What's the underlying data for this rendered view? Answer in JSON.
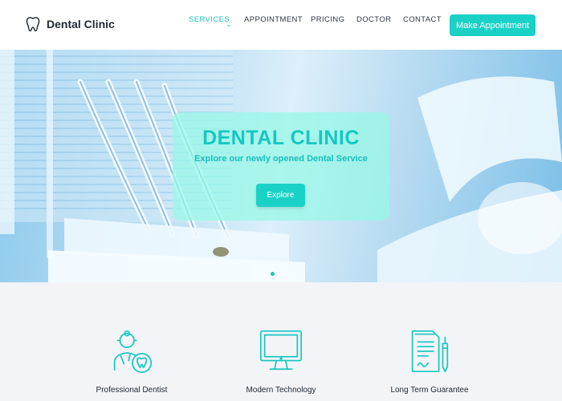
{
  "brand": {
    "name": "Dental Clinic",
    "icon": "tooth-icon"
  },
  "nav": {
    "items": [
      {
        "label": "SERVICES",
        "active": true,
        "has_dropdown": true
      },
      {
        "label": "APPOINTMENT",
        "active": false
      },
      {
        "label": "PRICING",
        "active": false
      },
      {
        "label": "DOCTOR",
        "active": false
      },
      {
        "label": "CONTACT",
        "active": false
      }
    ],
    "cta_label": "Make Appointment"
  },
  "hero": {
    "title": "DENTAL CLINIC",
    "subtitle": "Explore our newly opened Dental Service",
    "button_label": "Explore",
    "slide_count": 3,
    "active_slide": 1
  },
  "features": [
    {
      "label": "Professional Dentist",
      "icon": "dentist-icon"
    },
    {
      "label": "Modern Technology",
      "icon": "monitor-icon"
    },
    {
      "label": "Long Term Guarantee",
      "icon": "document-pen-icon"
    }
  ],
  "colors": {
    "accent": "#1ad1c6",
    "accent_text": "#17c3c0",
    "dark_text": "#1f2a36",
    "features_bg": "#f2f4f7"
  }
}
